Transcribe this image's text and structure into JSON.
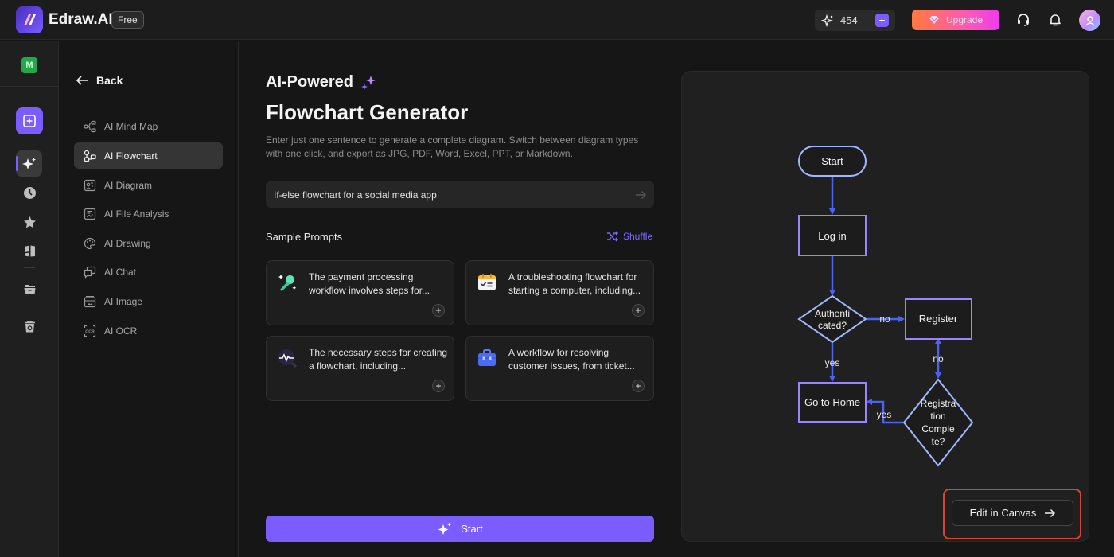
{
  "app": {
    "brand": "Edraw.AI",
    "plan_badge": "Free"
  },
  "topbar": {
    "credits": "454",
    "upgrade_label": "Upgrade",
    "icons": [
      "sparkle-icon",
      "plus-icon",
      "diamond-icon",
      "headset-icon",
      "bell-icon",
      "avatar"
    ]
  },
  "rail": {
    "workspace_initial": "M",
    "items": [
      "new-file",
      "ai-tools",
      "recent",
      "favorites",
      "templates",
      "files",
      "trash"
    ]
  },
  "subnav": {
    "back_label": "Back",
    "items": [
      {
        "label": "AI Mind Map",
        "icon": "mindmap-icon",
        "active": false
      },
      {
        "label": "AI Flowchart",
        "icon": "flowchart-icon",
        "active": true
      },
      {
        "label": "AI Diagram",
        "icon": "diagram-icon",
        "active": false
      },
      {
        "label": "AI File Analysis",
        "icon": "file-analysis-icon",
        "active": false
      },
      {
        "label": "AI Drawing",
        "icon": "palette-icon",
        "active": false
      },
      {
        "label": "AI Chat",
        "icon": "chat-icon",
        "active": false
      },
      {
        "label": "AI Image",
        "icon": "image-icon",
        "active": false
      },
      {
        "label": "AI OCR",
        "icon": "ocr-icon",
        "active": false
      }
    ]
  },
  "main": {
    "eyebrow": "AI-Powered",
    "title": "Flowchart Generator",
    "description": "Enter just one sentence to generate a complete diagram. Switch between diagram types with one click, and export as JPG, PDF, Word, Excel, PPT, or Markdown.",
    "prompt_value": "If-else flowchart for a social media app",
    "sample_prompts_label": "Sample Prompts",
    "shuffle_label": "Shuffle",
    "samples": [
      {
        "text": "The payment processing workflow involves steps for...",
        "icon": "microphone-icon"
      },
      {
        "text": "A troubleshooting flowchart for starting a computer, including...",
        "icon": "calendar-checklist-icon"
      },
      {
        "text": "The necessary steps for creating a flowchart, including...",
        "icon": "pulse-search-icon"
      },
      {
        "text": "A workflow for resolving customer issues, from ticket...",
        "icon": "briefcase-icon"
      }
    ],
    "start_label": "Start"
  },
  "preview": {
    "flowchart": {
      "nodes": {
        "start": "Start",
        "login": "Log in",
        "auth": [
          "Authenti",
          "cated?"
        ],
        "register": "Register",
        "home": "Go to Home",
        "regcomplete": [
          "Registra",
          "tion",
          "Comple",
          "te?"
        ]
      },
      "edges": {
        "auth_no": "no",
        "auth_yes": "yes",
        "reg_no": "no",
        "reg_yes": "yes"
      }
    },
    "edit_label": "Edit in Canvas"
  },
  "colors": {
    "accent": "#7b5cff",
    "flow_edge": "#4b63f0",
    "flow_box": "#9b84ff",
    "flow_terminal": "#9fb8ff",
    "highlight": "#d9452e"
  }
}
